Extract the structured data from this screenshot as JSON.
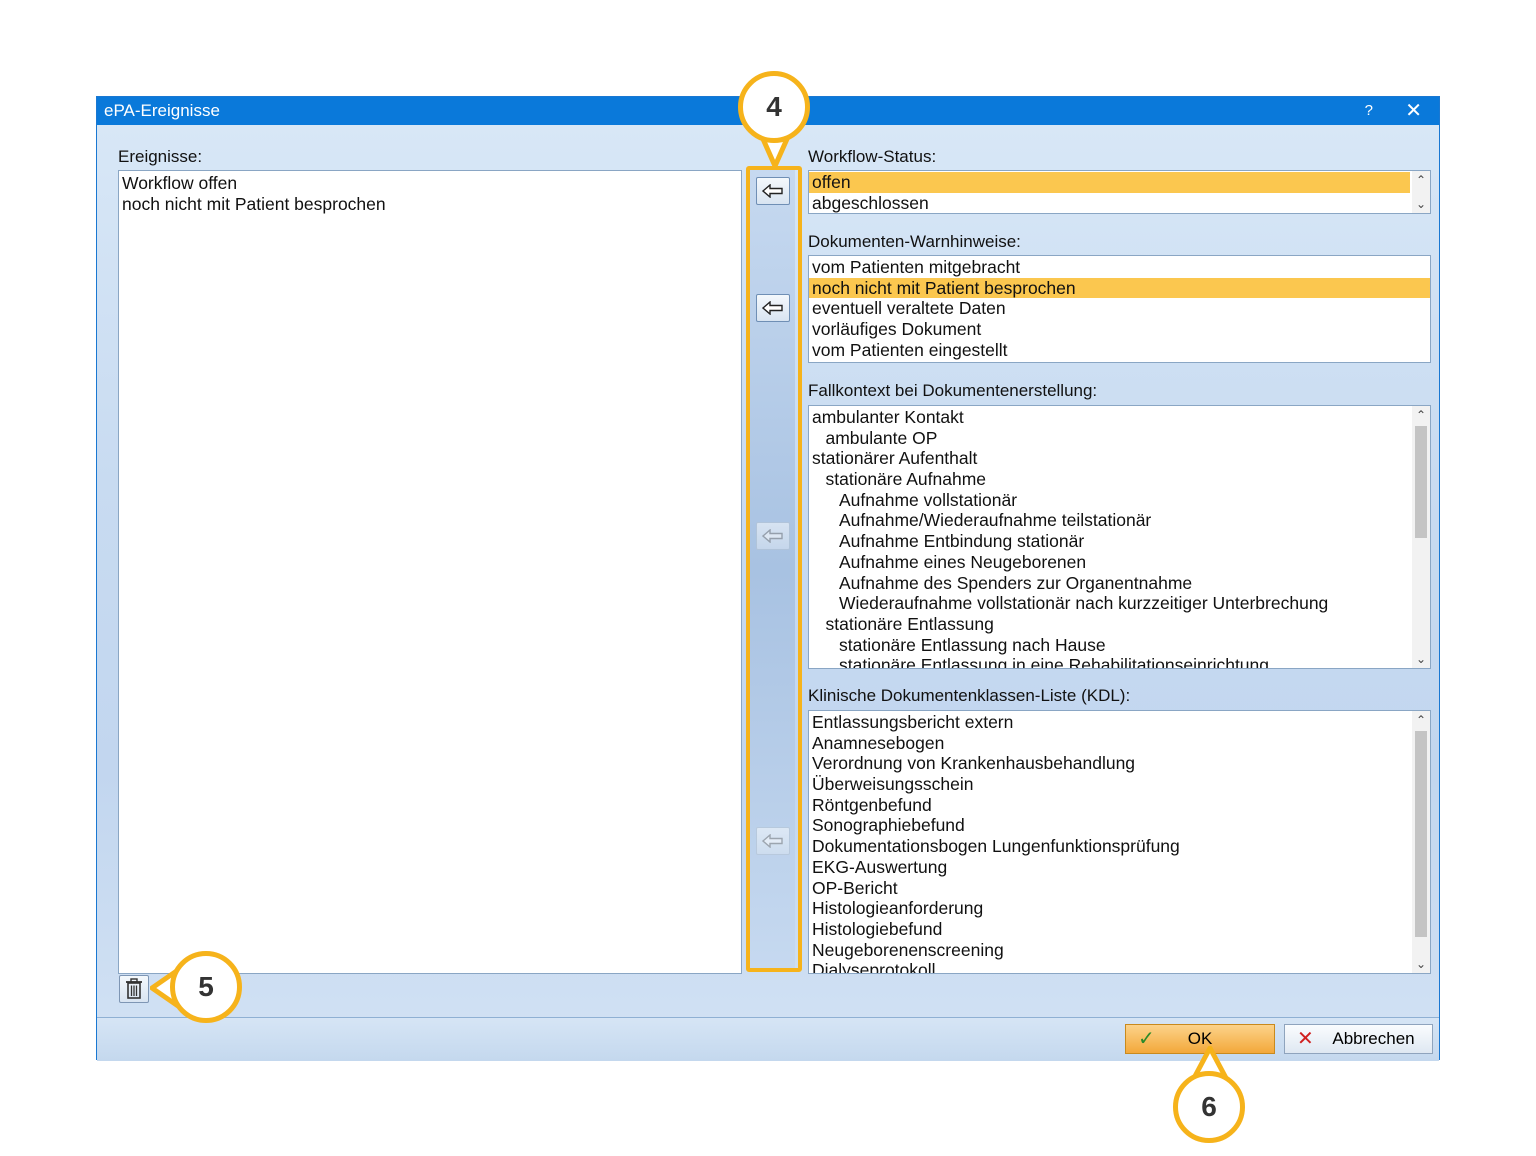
{
  "window": {
    "title": "ePA-Ereignisse",
    "help_glyph": "?",
    "close_glyph": "✕"
  },
  "events": {
    "label": "Ereignisse:",
    "items": [
      "Workflow offen",
      "noch nicht mit Patient besprochen"
    ]
  },
  "workflow_status": {
    "label": "Workflow-Status:",
    "items": [
      {
        "text": "offen",
        "selected": true
      },
      {
        "text": "abgeschlossen",
        "selected": false
      }
    ]
  },
  "warnings": {
    "label": "Dokumenten-Warnhinweise:",
    "items": [
      {
        "text": "vom Patienten mitgebracht",
        "selected": false
      },
      {
        "text": "noch nicht mit Patient besprochen",
        "selected": true
      },
      {
        "text": "eventuell veraltete Daten",
        "selected": false
      },
      {
        "text": "vorläufiges Dokument",
        "selected": false
      },
      {
        "text": "vom Patienten eingestellt",
        "selected": false
      }
    ]
  },
  "case_context": {
    "label": "Fallkontext bei Dokumentenerstellung:",
    "items": [
      {
        "text": "ambulanter Kontakt",
        "level": 0
      },
      {
        "text": "ambulante OP",
        "level": 1
      },
      {
        "text": "stationärer Aufenthalt",
        "level": 0
      },
      {
        "text": "stationäre Aufnahme",
        "level": 1
      },
      {
        "text": "Aufnahme vollstationär",
        "level": 2
      },
      {
        "text": "Aufnahme/Wiederaufnahme teilstationär",
        "level": 2
      },
      {
        "text": "Aufnahme Entbindung stationär",
        "level": 2
      },
      {
        "text": "Aufnahme eines Neugeborenen",
        "level": 2
      },
      {
        "text": "Aufnahme des Spenders zur Organentnahme",
        "level": 2
      },
      {
        "text": "Wiederaufnahme vollstationär nach kurzzeitiger Unterbrechung",
        "level": 2
      },
      {
        "text": "stationäre Entlassung",
        "level": 1
      },
      {
        "text": "stationäre Entlassung nach Hause",
        "level": 2
      },
      {
        "text": "stationäre Entlassung in eine Rehabilitationseinrichtung",
        "level": 2
      }
    ]
  },
  "kdl": {
    "label": "Klinische Dokumentenklassen-Liste (KDL):",
    "items": [
      "Entlassungsbericht extern",
      "Anamnesebogen",
      "Verordnung von Krankenhausbehandlung",
      "Überweisungsschein",
      "Röntgenbefund",
      "Sonographiebefund",
      "Dokumentationsbogen Lungenfunktionsprüfung",
      "EKG-Auswertung",
      "OP-Bericht",
      "Histologieanforderung",
      "Histologiebefund",
      "Neugeborenenscreening",
      "Dialyseprotokoll"
    ]
  },
  "buttons": {
    "ok": "OK",
    "cancel": "Abbrechen",
    "ok_icon": "✓",
    "cancel_icon": "✕"
  },
  "callouts": {
    "c4": "4",
    "c5": "5",
    "c6": "6"
  },
  "colors": {
    "title_bar": "#0a79da",
    "selection": "#fbc74f",
    "highlight_frame": "#f6b31b"
  }
}
